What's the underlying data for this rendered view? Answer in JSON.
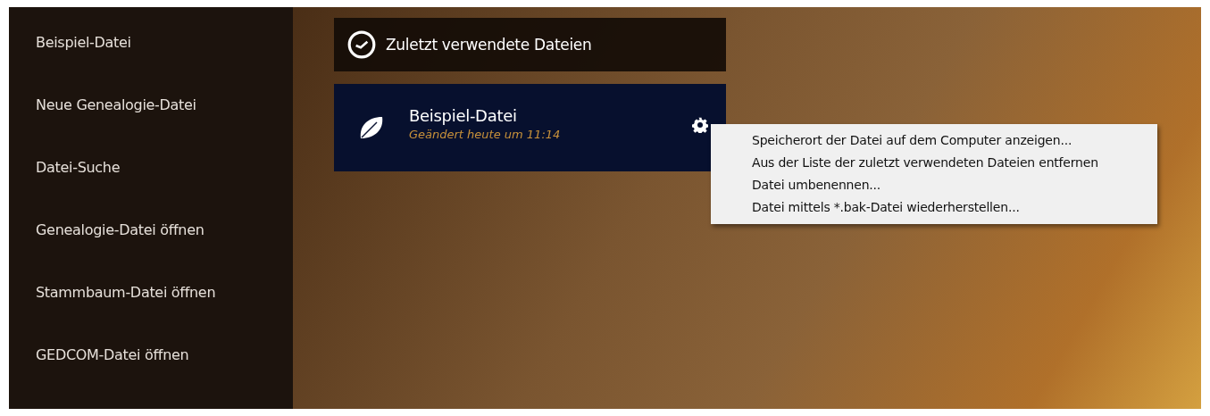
{
  "sidebar": {
    "items": [
      {
        "label": "Beispiel-Datei"
      },
      {
        "label": "Neue Genealogie-Datei"
      },
      {
        "label": "Datei-Suche"
      },
      {
        "label": "Genealogie-Datei öffnen"
      },
      {
        "label": "Stammbaum-Datei öffnen"
      },
      {
        "label": "GEDCOM-Datei öffnen"
      }
    ]
  },
  "recent": {
    "title": "Zuletzt verwendete Dateien",
    "files": [
      {
        "name": "Beispiel-Datei",
        "modified": "Geändert heute um 11:14"
      }
    ]
  },
  "context_menu": {
    "items": [
      "Speicherort der Datei auf dem Computer anzeigen...",
      "Aus der Liste der zuletzt verwendeten Dateien entfernen",
      "Datei umbenennen...",
      "Datei mittels *.bak-Datei wiederherstellen..."
    ]
  }
}
